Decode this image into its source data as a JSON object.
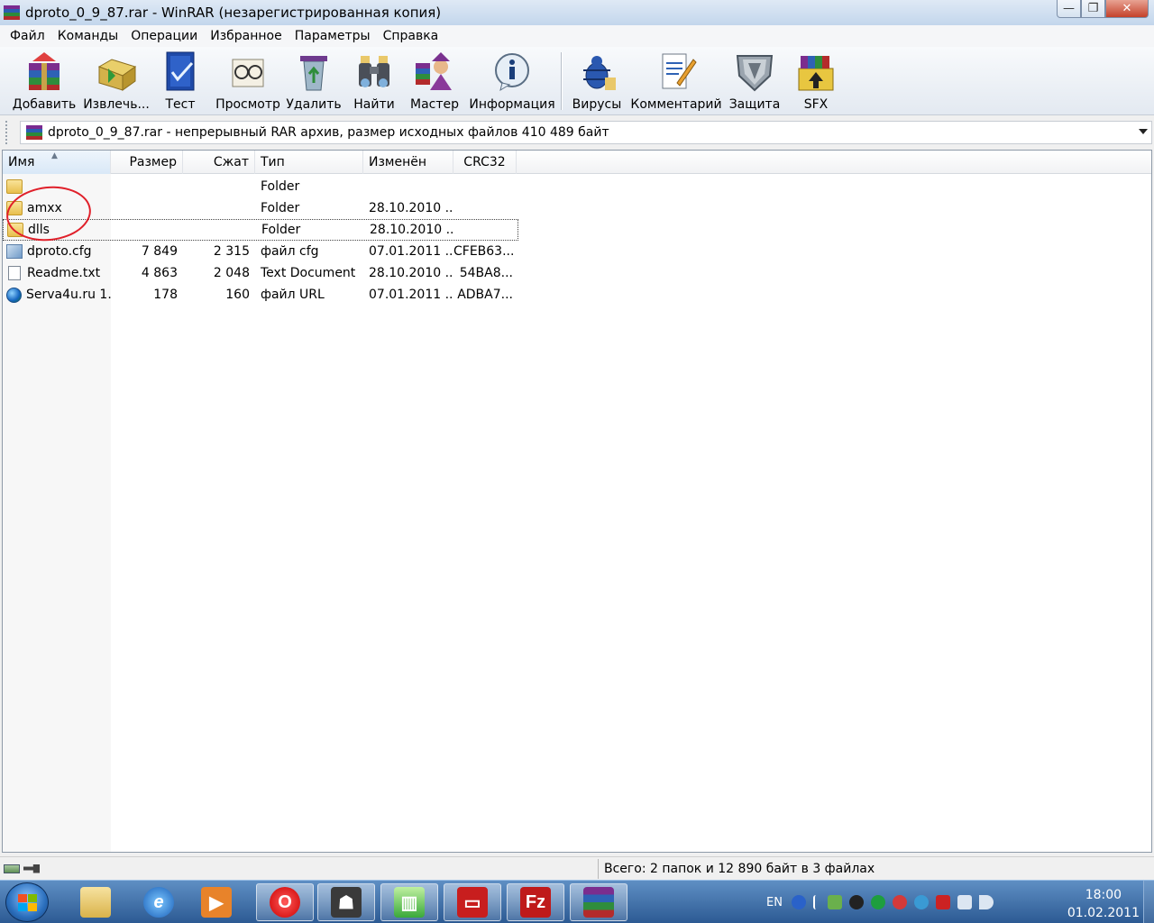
{
  "window": {
    "title": "dproto_0_9_87.rar - WinRAR (незарегистрированная копия)",
    "minimize": "—",
    "maximize": "❐",
    "close": "✕"
  },
  "menu": [
    "Файл",
    "Команды",
    "Операции",
    "Избранное",
    "Параметры",
    "Справка"
  ],
  "toolbar": [
    {
      "label": "Добавить",
      "icon": "add-books-icon"
    },
    {
      "label": "Извлечь...",
      "icon": "extract-folder-icon"
    },
    {
      "label": "Тест",
      "icon": "test-check-icon"
    },
    {
      "label": "Просмотр",
      "icon": "view-glasses-icon"
    },
    {
      "label": "Удалить",
      "icon": "delete-recycle-icon"
    },
    {
      "label": "Найти",
      "icon": "find-binoculars-icon"
    },
    {
      "label": "Мастер",
      "icon": "wizard-icon"
    },
    {
      "label": "Информация",
      "icon": "info-icon"
    },
    {
      "label": "Вирусы",
      "icon": "virus-scan-icon"
    },
    {
      "label": "Комментарий",
      "icon": "comment-icon"
    },
    {
      "label": "Защита",
      "icon": "protect-shield-icon"
    },
    {
      "label": "SFX",
      "icon": "sfx-icon"
    }
  ],
  "address": {
    "text": "dproto_0_9_87.rar - непрерывный RAR архив, размер исходных файлов 410 489 байт"
  },
  "columns": {
    "name": "Имя",
    "size": "Размер",
    "packed": "Сжат",
    "type": "Тип",
    "modified": "Изменён",
    "crc": "CRC32"
  },
  "files": [
    {
      "name": "",
      "size": "",
      "packed": "",
      "type": "Folder",
      "modified": "",
      "crc": "",
      "kind": "folder"
    },
    {
      "name": "amxx",
      "size": "",
      "packed": "",
      "type": "Folder",
      "modified": "28.10.2010 ...",
      "crc": "",
      "kind": "folder"
    },
    {
      "name": "dlls",
      "size": "",
      "packed": "",
      "type": "Folder",
      "modified": "28.10.2010 ...",
      "crc": "",
      "kind": "folder"
    },
    {
      "name": "dproto.cfg",
      "size": "7 849",
      "packed": "2 315",
      "type": "файл cfg",
      "modified": "07.01.2011 ...",
      "crc": "CFEB63...",
      "kind": "cfg"
    },
    {
      "name": "Readme.txt",
      "size": "4 863",
      "packed": "2 048",
      "type": "Text Document",
      "modified": "28.10.2010 ...",
      "crc": "54BA8...",
      "kind": "txt"
    },
    {
      "name": "Serva4u.ru 1...",
      "size": "178",
      "packed": "160",
      "type": "файл URL",
      "modified": "07.01.2011 ...",
      "crc": "ADBA7...",
      "kind": "url"
    }
  ],
  "status": {
    "text": "Всего: 2 папок и 12 890 байт в 3 файлах"
  },
  "taskbar": {
    "apps": [
      "explorer",
      "internet-explorer",
      "media-player",
      "opera",
      "counter-strike",
      "app-green",
      "remote-desktop",
      "filezilla",
      "winrar"
    ],
    "lang": "EN",
    "time": "18:00",
    "date": "01.02.2011"
  }
}
